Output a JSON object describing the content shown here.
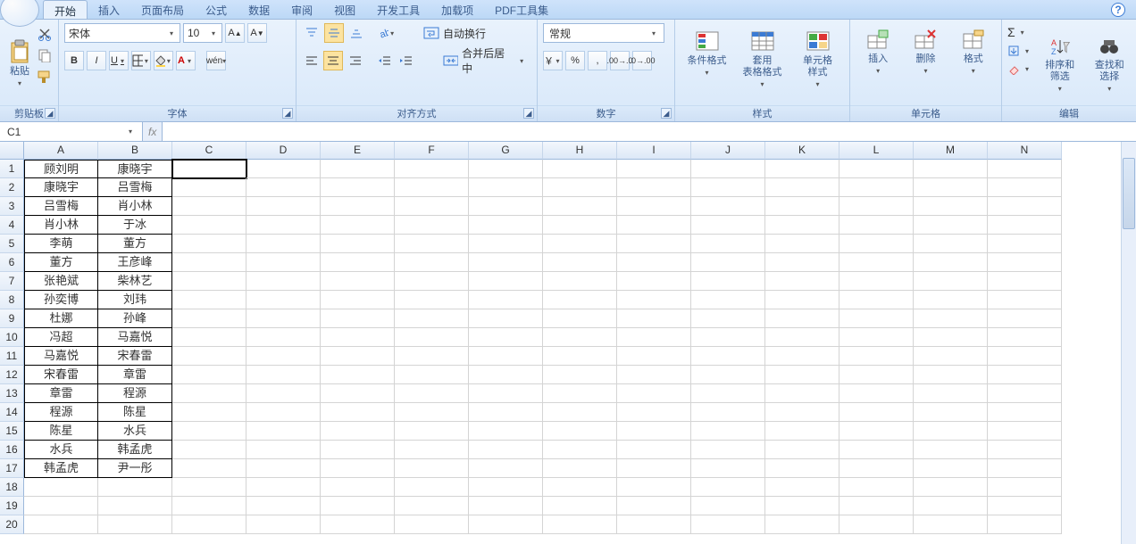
{
  "tabs": {
    "items": [
      "开始",
      "插入",
      "页面布局",
      "公式",
      "数据",
      "审阅",
      "视图",
      "开发工具",
      "加载项",
      "PDF工具集"
    ],
    "active": 0
  },
  "ribbon": {
    "clipboard": {
      "label": "剪贴板",
      "paste": "粘贴"
    },
    "font": {
      "label": "字体",
      "name": "宋体",
      "size": "10",
      "bold": "B",
      "italic": "I",
      "underline": "U"
    },
    "align": {
      "label": "对齐方式",
      "wrap": "自动换行",
      "merge": "合并后居中"
    },
    "number": {
      "label": "数字",
      "format": "常规"
    },
    "styles": {
      "label": "样式",
      "conditional": "条件格式",
      "tableStyle": "套用\n表格格式",
      "cellStyle": "单元格\n样式"
    },
    "cells": {
      "label": "单元格",
      "insert": "插入",
      "delete": "删除",
      "format": "格式"
    },
    "edit": {
      "label": "编辑",
      "sortFilter": "排序和\n筛选",
      "findSelect": "查找和\n选择"
    }
  },
  "fx": {
    "cellRef": "C1",
    "formula": "",
    "fxLabel": "fx"
  },
  "grid": {
    "columns": [
      "A",
      "B",
      "C",
      "D",
      "E",
      "F",
      "G",
      "H",
      "I",
      "J",
      "K",
      "L",
      "M",
      "N"
    ],
    "rows": [
      {
        "A": "顾刘明",
        "B": "康晓宇"
      },
      {
        "A": "康晓宇",
        "B": "吕雪梅"
      },
      {
        "A": "吕雪梅",
        "B": "肖小林"
      },
      {
        "A": "肖小林",
        "B": "于冰"
      },
      {
        "A": "李萌",
        "B": "董方"
      },
      {
        "A": "董方",
        "B": "王彦峰"
      },
      {
        "A": "张艳斌",
        "B": "柴林艺"
      },
      {
        "A": "孙奕博",
        "B": "刘玮"
      },
      {
        "A": "杜娜",
        "B": "孙峰"
      },
      {
        "A": "冯超",
        "B": "马嘉悦"
      },
      {
        "A": "马嘉悦",
        "B": "宋春雷"
      },
      {
        "A": "宋春雷",
        "B": "章雷"
      },
      {
        "A": "章雷",
        "B": "程源"
      },
      {
        "A": "程源",
        "B": "陈星"
      },
      {
        "A": "陈星",
        "B": "水兵"
      },
      {
        "A": "水兵",
        "B": "韩孟虎"
      },
      {
        "A": "韩孟虎",
        "B": "尹一彤"
      }
    ],
    "selectedCell": "C1",
    "visibleRows": 20
  }
}
